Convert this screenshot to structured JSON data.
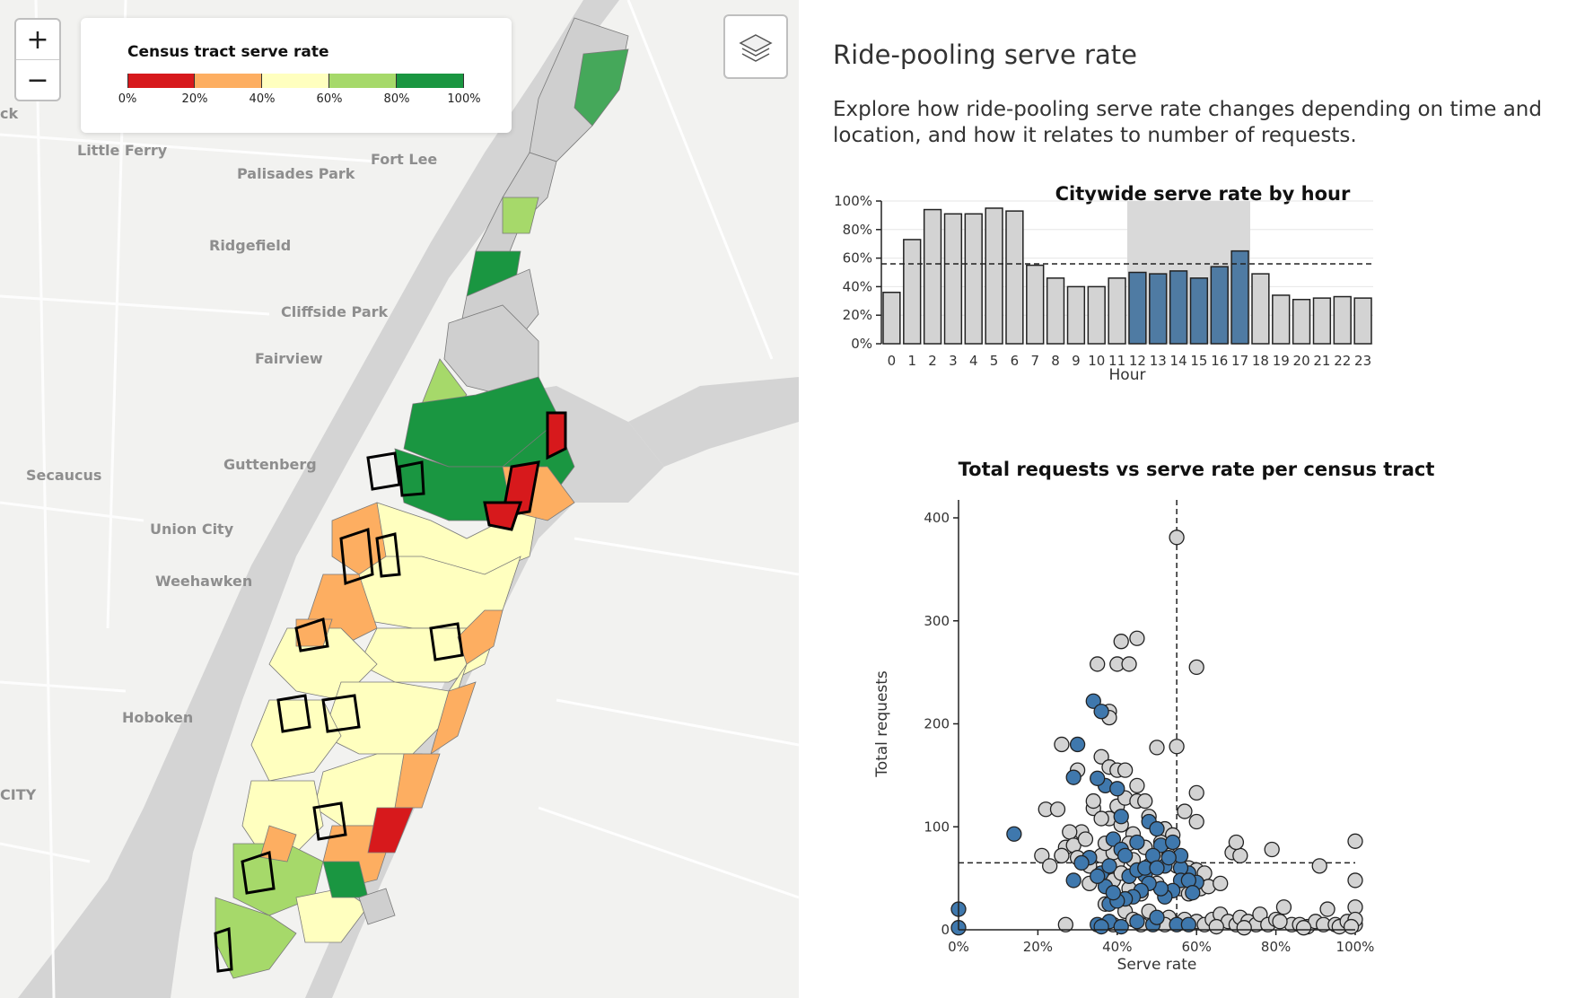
{
  "map": {
    "zoom_in": "+",
    "zoom_out": "−",
    "legend": {
      "title": "Census tract serve rate",
      "ticks": [
        "0%",
        "20%",
        "40%",
        "60%",
        "80%",
        "100%"
      ],
      "colors": [
        "#d7191c",
        "#fdae61",
        "#ffffbf",
        "#a6d96a",
        "#1a9641"
      ]
    },
    "places": [
      {
        "name": "Little Ferry"
      },
      {
        "name": "Palisades Park"
      },
      {
        "name": "Fort Lee"
      },
      {
        "name": "Ridgefield"
      },
      {
        "name": "Cliffside Park"
      },
      {
        "name": "Fairview"
      },
      {
        "name": "Secaucus"
      },
      {
        "name": "Guttenberg"
      },
      {
        "name": "Union City"
      },
      {
        "name": "Weehawken"
      },
      {
        "name": "Hoboken"
      },
      {
        "name": "CITY"
      },
      {
        "name": "ck"
      }
    ],
    "icons": {
      "layers": "layers-icon"
    }
  },
  "panel": {
    "title": "Ride-pooling serve rate",
    "description": "Explore how ride-pooling serve rate changes depending on time and location, and how it relates to number of requests."
  },
  "chart_data": [
    {
      "type": "bar",
      "title": "Citywide serve rate by hour",
      "xlabel": "Hour",
      "ylabel": "",
      "categories": [
        "0",
        "1",
        "2",
        "3",
        "4",
        "5",
        "6",
        "7",
        "8",
        "9",
        "10",
        "11",
        "12",
        "13",
        "14",
        "15",
        "16",
        "17",
        "18",
        "19",
        "20",
        "21",
        "22",
        "23"
      ],
      "values": [
        36,
        73,
        94,
        91,
        91,
        95,
        93,
        55,
        46,
        40,
        40,
        46,
        50,
        49,
        51,
        46,
        54,
        65,
        49,
        34,
        31,
        32,
        33,
        32
      ],
      "selected_range": [
        12,
        17
      ],
      "reference_line": 56,
      "ylim": [
        0,
        100
      ],
      "yticks": [
        "0%",
        "20%",
        "40%",
        "60%",
        "80%",
        "100%"
      ],
      "colors": {
        "default": "#d3d3d3",
        "selected": "#4f7ba3",
        "highlight_band": "#d9d9d9"
      }
    },
    {
      "type": "scatter",
      "title": "Total requests vs serve rate per census tract",
      "xlabel": "Serve rate",
      "ylabel": "Total requests",
      "xlim": [
        0,
        100
      ],
      "ylim": [
        0,
        400
      ],
      "xticks": [
        "0%",
        "20%",
        "40%",
        "60%",
        "80%",
        "100%"
      ],
      "yticks": [
        "0",
        "100",
        "200",
        "300",
        "400"
      ],
      "reference_x": 55,
      "reference_y": 65,
      "colors": {
        "default": "#d3d3d3",
        "selected": "#3f78ad"
      },
      "series": [
        {
          "highlighted": false,
          "points": [
            [
              55,
              381
            ],
            [
              41,
              280
            ],
            [
              45,
              283
            ],
            [
              40,
              258
            ],
            [
              60,
              255
            ],
            [
              35,
              258
            ],
            [
              43,
              258
            ],
            [
              38,
              212
            ],
            [
              38,
              206
            ],
            [
              50,
              177
            ],
            [
              55,
              178
            ],
            [
              26,
              180
            ],
            [
              36,
              168
            ],
            [
              38,
              158
            ],
            [
              40,
              155
            ],
            [
              42,
              155
            ],
            [
              45,
              140
            ],
            [
              30,
              155
            ],
            [
              34,
              118
            ],
            [
              22,
              117
            ],
            [
              25,
              117
            ],
            [
              40,
              120
            ],
            [
              60,
              133
            ],
            [
              57,
              115
            ],
            [
              60,
              105
            ],
            [
              42,
              128
            ],
            [
              45,
              125
            ],
            [
              47,
              125
            ],
            [
              38,
              108
            ],
            [
              31,
              95
            ],
            [
              28,
              95
            ],
            [
              27,
              80
            ],
            [
              29,
              82
            ],
            [
              21,
              72
            ],
            [
              26,
              72
            ],
            [
              30,
              70
            ],
            [
              33,
              62
            ],
            [
              36,
              72
            ],
            [
              40,
              65
            ],
            [
              44,
              68
            ],
            [
              48,
              62
            ],
            [
              53,
              72
            ],
            [
              55,
              62
            ],
            [
              58,
              60
            ],
            [
              60,
              58
            ],
            [
              62,
              55
            ],
            [
              23,
              62
            ],
            [
              26,
              72
            ],
            [
              33,
              45
            ],
            [
              39,
              48
            ],
            [
              41,
              55
            ],
            [
              43,
              40
            ],
            [
              46,
              35
            ],
            [
              50,
              45
            ],
            [
              56,
              40
            ],
            [
              58,
              35
            ],
            [
              61,
              40
            ],
            [
              63,
              42
            ],
            [
              66,
              45
            ],
            [
              69,
              75
            ],
            [
              71,
              72
            ],
            [
              70,
              85
            ],
            [
              79,
              78
            ],
            [
              91,
              62
            ],
            [
              100,
              86
            ],
            [
              100,
              48
            ],
            [
              100,
              22
            ],
            [
              37,
              25
            ],
            [
              42,
              18
            ],
            [
              44,
              10
            ],
            [
              48,
              18
            ],
            [
              53,
              12
            ],
            [
              57,
              10
            ],
            [
              60,
              8
            ],
            [
              62,
              5
            ],
            [
              64,
              10
            ],
            [
              66,
              15
            ],
            [
              68,
              8
            ],
            [
              70,
              5
            ],
            [
              71,
              12
            ],
            [
              73,
              8
            ],
            [
              75,
              5
            ],
            [
              76,
              15
            ],
            [
              78,
              5
            ],
            [
              80,
              10
            ],
            [
              82,
              22
            ],
            [
              84,
              5
            ],
            [
              86,
              5
            ],
            [
              88,
              3
            ],
            [
              90,
              8
            ],
            [
              92,
              5
            ],
            [
              93,
              20
            ],
            [
              95,
              5
            ],
            [
              96,
              3
            ],
            [
              98,
              8
            ],
            [
              100,
              5
            ],
            [
              100,
              10
            ],
            [
              27,
              5
            ],
            [
              39,
              5
            ],
            [
              46,
              5
            ],
            [
              52,
              5
            ],
            [
              65,
              3
            ],
            [
              72,
              2
            ],
            [
              81,
              8
            ],
            [
              87,
              2
            ],
            [
              99,
              3
            ],
            [
              48,
              110
            ],
            [
              52,
              98
            ],
            [
              54,
              92
            ],
            [
              44,
              93
            ],
            [
              41,
              102
            ],
            [
              36,
              108
            ],
            [
              34,
              125
            ],
            [
              47,
              80
            ],
            [
              51,
              85
            ],
            [
              39,
              75
            ],
            [
              37,
              84
            ],
            [
              43,
              84
            ],
            [
              32,
              88
            ]
          ]
        },
        {
          "highlighted": true,
          "points": [
            [
              0,
              20
            ],
            [
              0,
              2
            ],
            [
              14,
              93
            ],
            [
              34,
              222
            ],
            [
              36,
              212
            ],
            [
              30,
              180
            ],
            [
              37,
              140
            ],
            [
              35,
              147
            ],
            [
              40,
              137
            ],
            [
              29,
              148
            ],
            [
              41,
              110
            ],
            [
              48,
              105
            ],
            [
              50,
              98
            ],
            [
              51,
              82
            ],
            [
              54,
              85
            ],
            [
              58,
              55
            ],
            [
              52,
              62
            ],
            [
              47,
              53
            ],
            [
              56,
              60
            ],
            [
              56,
              72
            ],
            [
              56,
              48
            ],
            [
              60,
              46
            ],
            [
              58,
              48
            ],
            [
              59,
              36
            ],
            [
              54,
              38
            ],
            [
              52,
              32
            ],
            [
              51,
              40
            ],
            [
              48,
              45
            ],
            [
              46,
              38
            ],
            [
              44,
              32
            ],
            [
              42,
              30
            ],
            [
              38,
              25
            ],
            [
              37,
              42
            ],
            [
              36,
              55
            ],
            [
              35,
              52
            ],
            [
              33,
              70
            ],
            [
              39,
              88
            ],
            [
              41,
              78
            ],
            [
              43,
              52
            ],
            [
              45,
              58
            ],
            [
              40,
              28
            ],
            [
              39,
              36
            ],
            [
              38,
              8
            ],
            [
              35,
              5
            ],
            [
              36,
              3
            ],
            [
              41,
              3
            ],
            [
              45,
              8
            ],
            [
              49,
              5
            ],
            [
              50,
              12
            ],
            [
              55,
              5
            ],
            [
              58,
              5
            ],
            [
              29,
              48
            ],
            [
              31,
              65
            ],
            [
              38,
              62
            ],
            [
              42,
              72
            ],
            [
              45,
              85
            ],
            [
              53,
              70
            ],
            [
              49,
              72
            ],
            [
              47,
              60
            ],
            [
              50,
              60
            ]
          ]
        }
      ]
    }
  ]
}
